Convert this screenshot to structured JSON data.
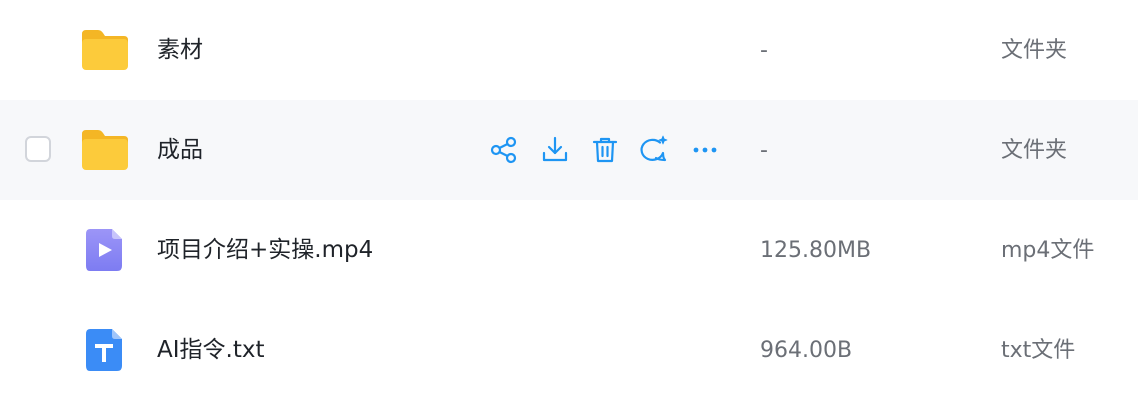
{
  "colors": {
    "action_blue": "#1e95f3",
    "row_hover_bg": "#f7f8fa",
    "folder_yellow": "#fccb3b",
    "video_purple": "#8a86f5",
    "text_file_blue": "#3b8cf6"
  },
  "files": [
    {
      "name": "素材",
      "size": "-",
      "type": "文件夹",
      "icon": "folder-icon"
    },
    {
      "name": "成品",
      "size": "-",
      "type": "文件夹",
      "icon": "folder-icon",
      "hovered": true
    },
    {
      "name": "项目介绍+实操.mp4",
      "size": "125.80MB",
      "type": "mp4文件",
      "icon": "video-file-icon"
    },
    {
      "name": "AI指令.txt",
      "size": "964.00B",
      "type": "txt文件",
      "icon": "text-file-icon"
    }
  ],
  "hover_actions": [
    "share-icon",
    "download-icon",
    "delete-icon",
    "ai-chat-icon",
    "more-icon"
  ]
}
